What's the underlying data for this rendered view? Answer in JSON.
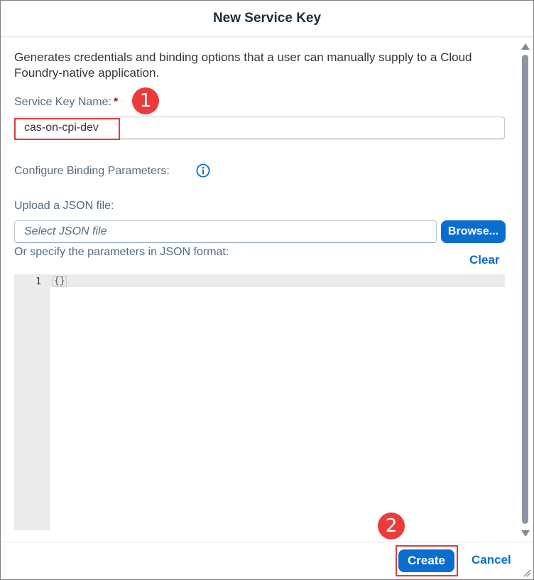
{
  "dialog": {
    "title": "New Service Key"
  },
  "form": {
    "description": "Generates credentials and binding options that a user can manually supply to a Cloud Foundry-native application.",
    "service_key_label": "Service Key Name:",
    "required_marker": "*",
    "service_key_value": "cas-on-cpi-dev",
    "binding_params_label": "Configure Binding Parameters:",
    "upload_label": "Upload a JSON file:",
    "file_placeholder": "Select JSON file",
    "browse_label": "Browse...",
    "json_format_label": "Or specify the parameters in JSON format:",
    "clear_label": "Clear"
  },
  "editor": {
    "line_number": "1",
    "code": "{}"
  },
  "annotations": {
    "step1": "1",
    "step2": "2",
    "color": "#ec3b3b"
  },
  "footer": {
    "create_label": "Create",
    "cancel_label": "Cancel"
  },
  "colors": {
    "accent": "#0a6ed1",
    "highlight": "#e03c3c",
    "required": "#aa0808"
  },
  "icons": {
    "info": "info-icon",
    "resize": "resize-handle-icon"
  }
}
